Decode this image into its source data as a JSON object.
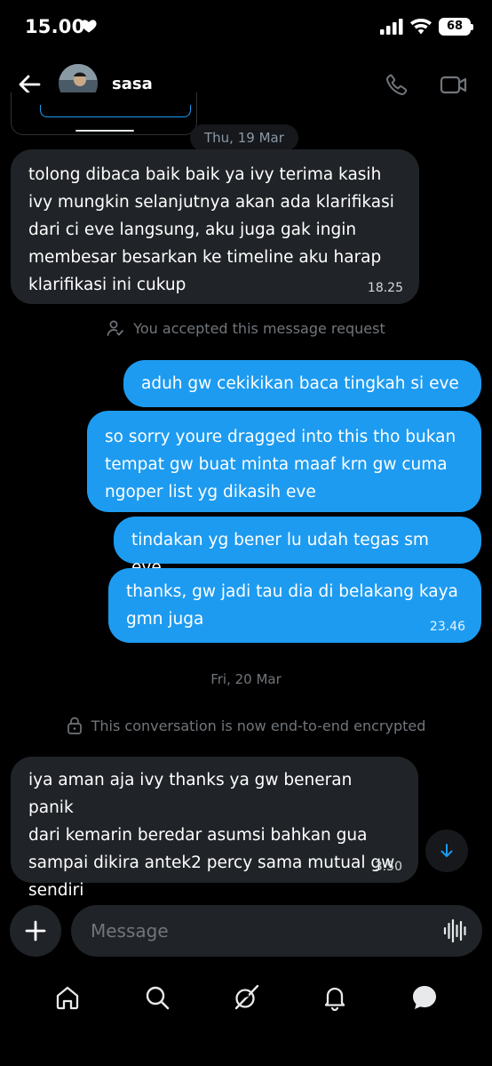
{
  "status_bar": {
    "time": "15.00",
    "battery": "68"
  },
  "header": {
    "contact_name": "sasa"
  },
  "conversation": {
    "date_separator_1": "Thu, 19 Mar",
    "message_1": {
      "text": "tolong dibaca baik baik ya ivy terima kasih\nivy mungkin selanjutnya akan ada klarifikasi\ndari ci eve langsung, aku juga gak ingin\nmembesar besarkan ke timeline aku harap\nklarifikasi ini cukup",
      "time": "18.25",
      "direction": "incoming"
    },
    "notice_request": "You accepted this message request",
    "message_2": {
      "text": "aduh gw cekikikan baca tingkah si eve",
      "direction": "outgoing"
    },
    "message_3": {
      "text": "so sorry youre dragged into this tho bukan\ntempat gw buat minta maaf krn gw cuma\nngoper list yg dikasih eve",
      "direction": "outgoing"
    },
    "message_4": {
      "text": "tindakan yg bener lu udah tegas sm eve",
      "direction": "outgoing"
    },
    "message_5": {
      "text": "thanks, gw jadi tau dia di belakang kaya\ngmn juga",
      "time": "23.46",
      "direction": "outgoing"
    },
    "date_separator_2": "Fri, 20 Mar",
    "notice_encrypted": "This conversation is now end-to-end encrypted",
    "message_6": {
      "text": "iya aman aja ivy thanks ya gw beneran panik\ndari kemarin beredar asumsi bahkan gua\nsampai dikira antek2 percy sama mutual gw\nsendiri",
      "time": "3.50",
      "direction": "incoming"
    }
  },
  "composer": {
    "placeholder": "Message",
    "value": ""
  },
  "bottom_nav": {
    "items": [
      "home-icon",
      "search-icon",
      "grok-icon",
      "notifications-icon",
      "messages-icon"
    ],
    "active": "messages-icon"
  },
  "colors": {
    "background": "#000000",
    "incoming_bubble": "#202327",
    "outgoing_bubble": "#1d9bf0",
    "muted_text": "#71767b",
    "accent": "#1d9bf0"
  }
}
